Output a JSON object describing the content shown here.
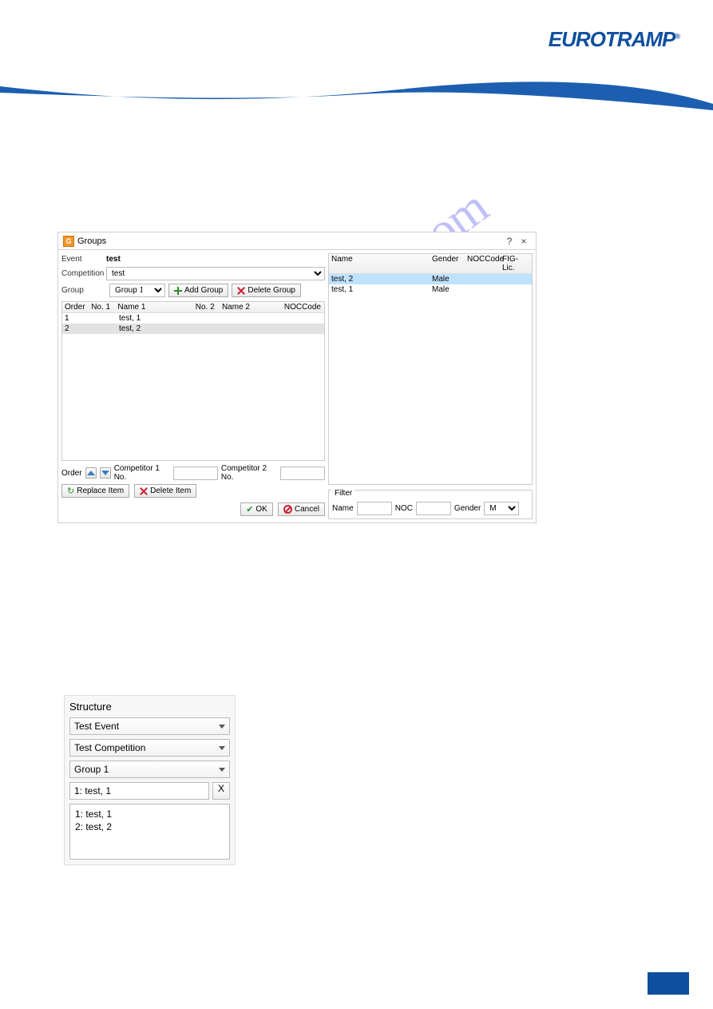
{
  "logo_text": "EUROTRAMP",
  "logo_reg": "®",
  "watermark_text": "manualshive.com",
  "dialog": {
    "title": "Groups",
    "help": "?",
    "close": "×",
    "event_label": "Event",
    "event_value": "test",
    "competition_label": "Competition",
    "competition_value": "test",
    "group_label": "Group",
    "group_value": "Group 1",
    "add_group_btn": "Add Group",
    "delete_group_btn": "Delete Group",
    "left_cols": {
      "order": "Order",
      "no1": "No. 1",
      "name1": "Name 1",
      "no2": "No. 2",
      "name2": "Name 2",
      "noc": "NOCCode"
    },
    "left_rows": [
      {
        "order": "1",
        "no1": "",
        "name1": "test, 1",
        "no2": "",
        "name2": ""
      },
      {
        "order": "2",
        "no1": "",
        "name1": "test, 2",
        "no2": "",
        "name2": ""
      }
    ],
    "right_cols": {
      "name": "Name",
      "gender": "Gender",
      "noc": "NOCCode",
      "fig": "FIG-Lic."
    },
    "right_rows": [
      {
        "name": "test, 2",
        "gender": "Male",
        "noc": "",
        "fig": "",
        "sel": true
      },
      {
        "name": "test, 1",
        "gender": "Male",
        "noc": "",
        "fig": ""
      }
    ],
    "order_label": "Order",
    "comp1_label": "Competitor 1 No.",
    "comp1_value": "",
    "comp2_label": "Competitor 2 No.",
    "comp2_value": "",
    "replace_btn": "Replace Item",
    "delete_item_btn": "Delete Item",
    "ok_btn": "OK",
    "cancel_btn": "Cancel",
    "filter_title": "Filter",
    "filter_name_label": "Name",
    "filter_name_value": "",
    "filter_noc_label": "NOC",
    "filter_noc_value": "",
    "filter_gender_label": "Gender",
    "filter_gender_value": "Male"
  },
  "structure": {
    "title": "Structure",
    "event_sel": "Test Event",
    "competition_sel": "Test Competition",
    "group_sel": "Group 1",
    "current": "1: test, 1",
    "x": "X",
    "list": [
      "1: test, 1",
      "2: test, 2"
    ]
  }
}
